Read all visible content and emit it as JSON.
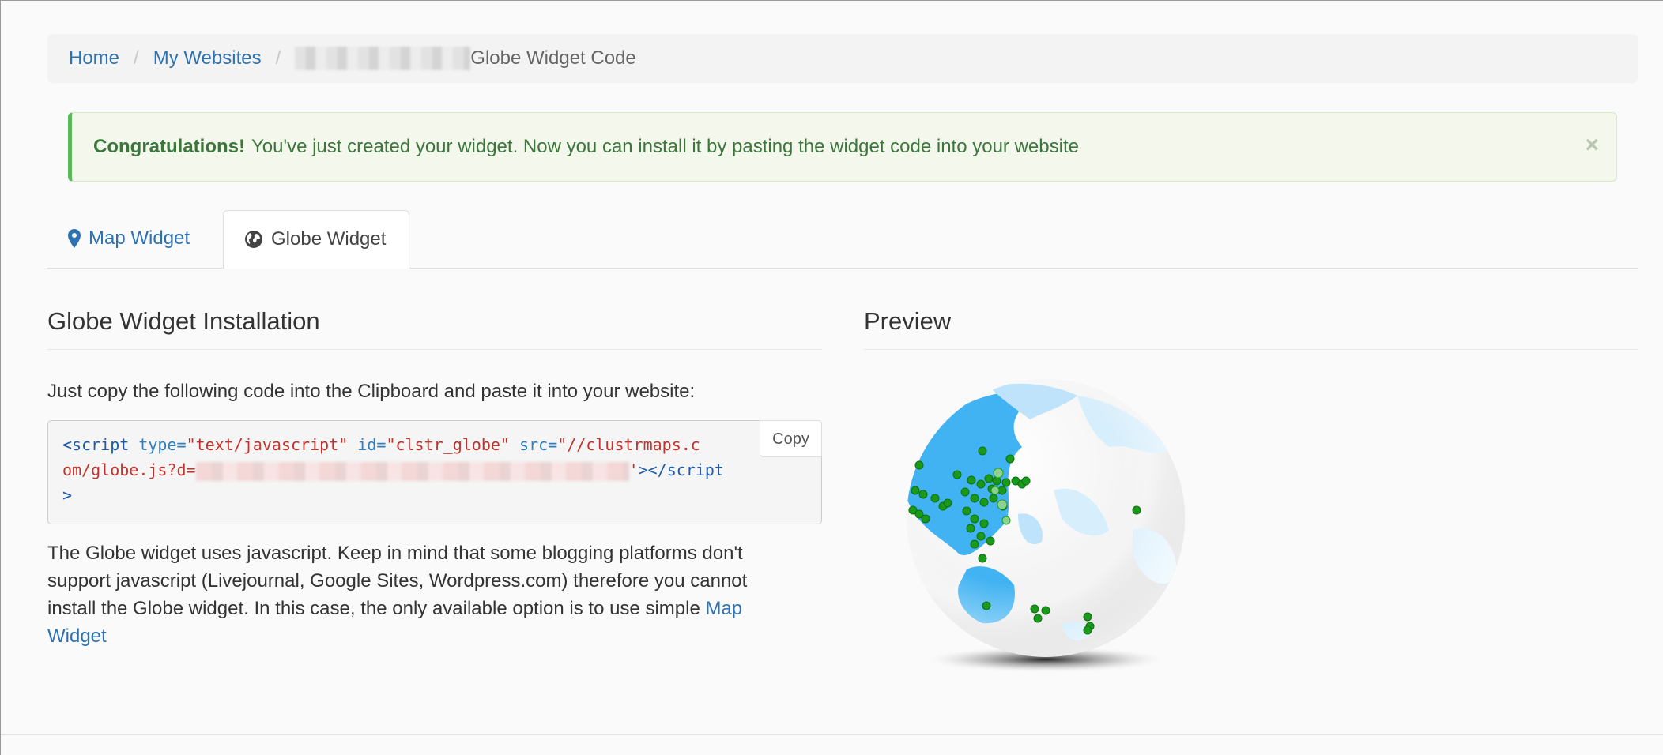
{
  "breadcrumb": {
    "home": "Home",
    "my_websites": "My Websites",
    "separator": "/",
    "current": "Globe Widget Code"
  },
  "alert": {
    "strong": "Congratulations!",
    "message": "You've just created your widget. Now you can install it by pasting the widget code into your website",
    "close": "×"
  },
  "tabs": {
    "map": "Map Widget",
    "globe": "Globe Widget"
  },
  "installation": {
    "title": "Globe Widget Installation",
    "instruction": "Just copy the following code into the Clipboard and paste it into your website:",
    "copy_button": "Copy",
    "code": {
      "open_tag": "<script",
      "type_attr": "type=",
      "type_val": "\"text/javascript\"",
      "id_attr": "id=",
      "id_val": "\"clstr_globe\"",
      "src_attr": "src=",
      "src_val_1": "\"//clustrmaps.c",
      "src_val_2": "om/globe.js?d=",
      "src_end": "'",
      "close_tag_1": "></script",
      "close_tag_2": ">"
    },
    "note": "The Globe widget uses javascript. Keep in mind that some blogging platforms don't support javascript (Livejournal, Google Sites, Wordpress.com) therefore you cannot install the Globe widget. In this case, the only available option is to use simple",
    "note_link": "Map Widget"
  },
  "preview": {
    "title": "Preview"
  },
  "colors": {
    "link": "#2f72b1",
    "success": "#3c763d",
    "ocean": "#42b3f2",
    "visitor_dot": "#1a9a1a"
  }
}
